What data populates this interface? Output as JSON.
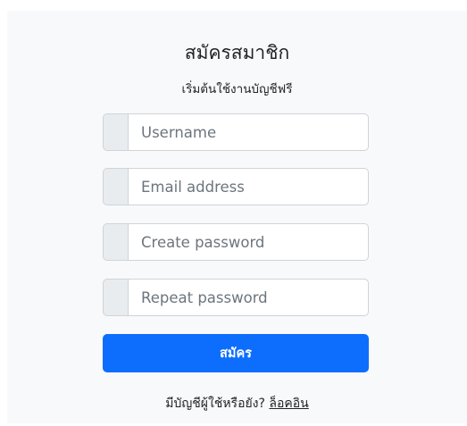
{
  "form": {
    "title": "สมัครสมาชิก",
    "subtitle": "เริ่มต้นใช้งานบัญชีฟรี",
    "fields": [
      {
        "placeholder": "Username",
        "value": ""
      },
      {
        "placeholder": "Email address",
        "value": ""
      },
      {
        "placeholder": "Create password",
        "value": ""
      },
      {
        "placeholder": "Repeat password",
        "value": ""
      }
    ],
    "submit_label": "สมัคร",
    "footer_text": "มีบัญชีผู้ใช้หรือยัง?",
    "login_link": "ล็อคอิน"
  },
  "colors": {
    "card_bg": "#f8f9fa",
    "primary": "#0d6efd",
    "addon_bg": "#e9ecef",
    "border": "#ced4da"
  }
}
